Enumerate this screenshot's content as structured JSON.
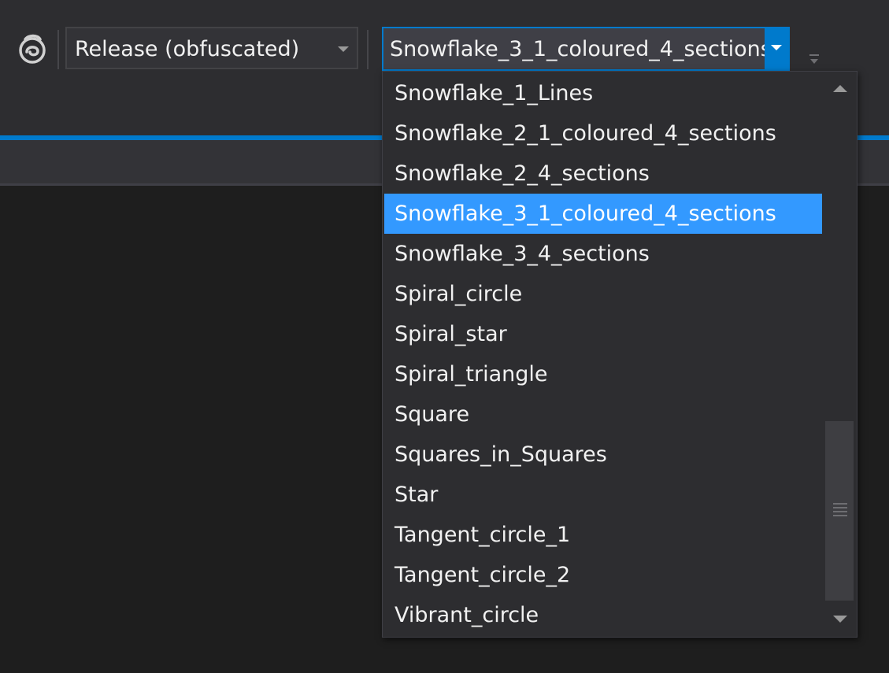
{
  "toolbar": {
    "app_icon": "swirl-logo-icon",
    "configuration": {
      "selected": "Release (obfuscated)"
    },
    "target": {
      "selected": "Snowflake_3_1_coloured_4_sections"
    },
    "overflow_icon": "toolbar-overflow-icon"
  },
  "dropdown": {
    "items": [
      "Snowflake_1_Lines",
      "Snowflake_2_1_coloured_4_sections",
      "Snowflake_2_4_sections",
      "Snowflake_3_1_coloured_4_sections",
      "Snowflake_3_4_sections",
      "Spiral_circle",
      "Spiral_star",
      "Spiral_triangle",
      "Square",
      "Squares_in_Squares",
      "Star",
      "Tangent_circle_1",
      "Tangent_circle_2",
      "Vibrant_circle"
    ],
    "selected_index": 3
  },
  "colors": {
    "background": "#1e1e1e",
    "toolbar": "#2d2d30",
    "accent": "#007acc",
    "selection": "#3399ff",
    "text": "#f1f1f1"
  }
}
